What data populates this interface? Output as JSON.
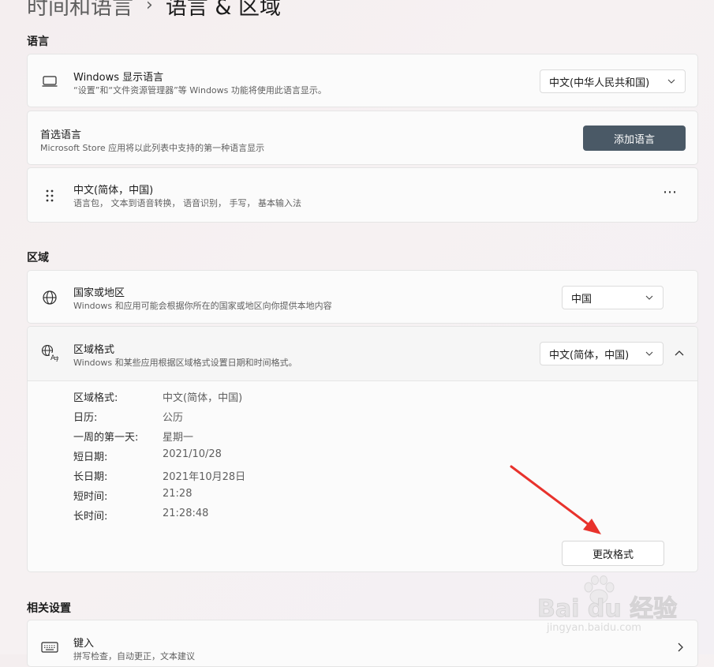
{
  "breadcrumb": {
    "parent": "时间和语言",
    "separator": "›",
    "current": "语言 & 区域"
  },
  "language_section": {
    "title": "语言",
    "display_language": {
      "title": "Windows 显示语言",
      "description": "“设置”和“文件资源管理器”等 Windows 功能将使用此语言显示。",
      "value": "中文(中华人民共和国)",
      "icon": "monitor-icon"
    },
    "preferred_language": {
      "title": "首选语言",
      "description": "Microsoft Store 应用将以此列表中支持的第一种语言显示",
      "button": "添加语言"
    },
    "installed_language": {
      "title": "中文(简体，中国)",
      "description": "语言包， 文本到语音转换， 语音识别， 手写， 基本输入法",
      "more": "⋯",
      "icon": "drag-handle-icon"
    }
  },
  "region_section": {
    "title": "区域",
    "country": {
      "title": "国家或地区",
      "description": "Windows 和应用可能会根据你所在的国家或地区向你提供本地内容",
      "value": "中国",
      "icon": "globe-icon"
    },
    "regional_format": {
      "title": "区域格式",
      "description": "Windows 和某些应用根据区域格式设置日期和时间格式。",
      "value": "中文(简体，中国)",
      "icon": "language-format-icon",
      "expanded": true,
      "details": [
        {
          "label": "区域格式:",
          "value": "中文(简体，中国)"
        },
        {
          "label": "日历:",
          "value": "公历"
        },
        {
          "label": "一周的第一天:",
          "value": "星期一"
        },
        {
          "label": "短日期:",
          "value": "2021/10/28"
        },
        {
          "label": "长日期:",
          "value": "2021年10月28日"
        },
        {
          "label": "短时间:",
          "value": "21:28"
        },
        {
          "label": "长时间:",
          "value": "21:28:48"
        }
      ],
      "change_button": "更改格式"
    }
  },
  "related_section": {
    "title": "相关设置",
    "typing": {
      "title": "键入",
      "description": "拼写检查，自动更正，文本建议",
      "icon": "keyboard-icon"
    }
  },
  "watermark": {
    "brand": "Bai du 经验",
    "url": "jingyan.baidu.com"
  },
  "colors": {
    "accent_button": "#4a5966",
    "annotation_arrow": "#e8322c"
  }
}
